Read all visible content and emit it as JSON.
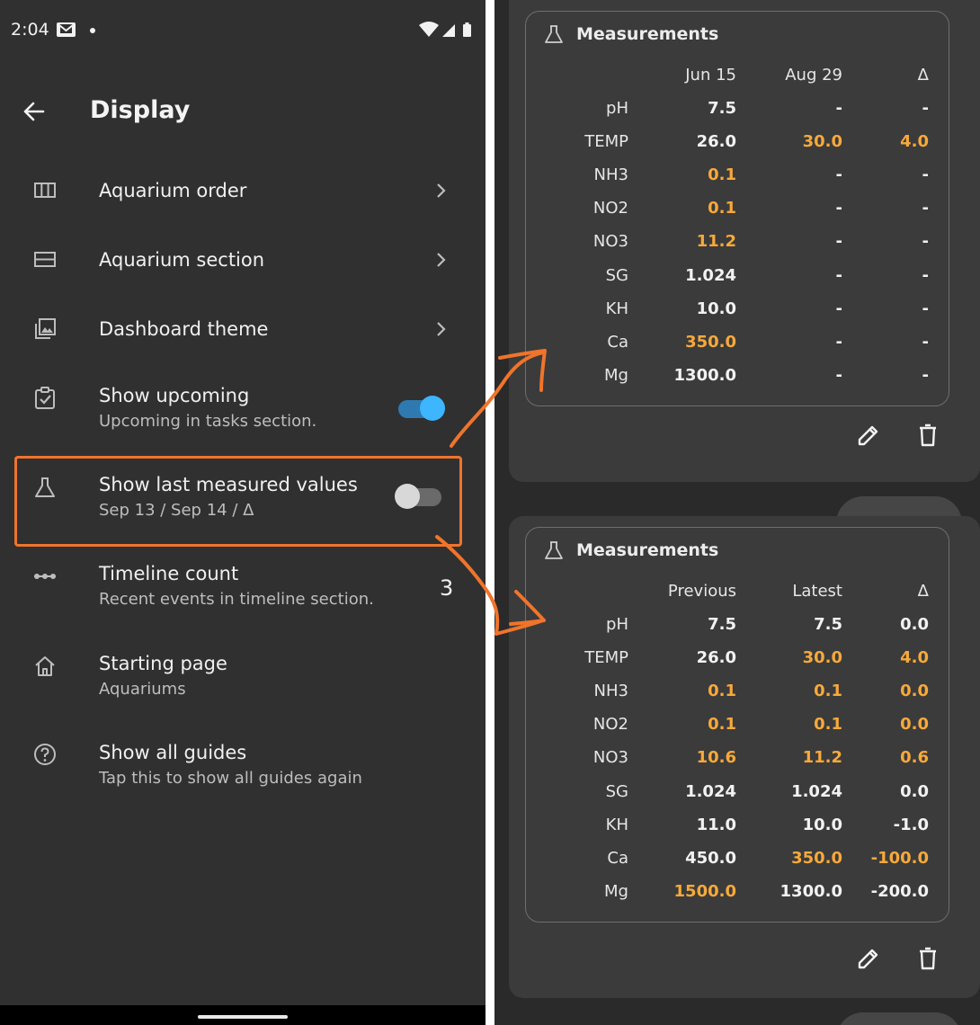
{
  "status_bar": {
    "time": "2:04"
  },
  "settings_screen": {
    "title": "Display",
    "items": [
      {
        "title": "Aquarium order"
      },
      {
        "title": "Aquarium section"
      },
      {
        "title": "Dashboard theme"
      },
      {
        "title": "Show upcoming",
        "subtitle": "Upcoming in tasks section.",
        "toggle": "on"
      },
      {
        "title": "Show last measured values",
        "subtitle": "Sep 13 / Sep 14 / Δ",
        "toggle": "off"
      },
      {
        "title": "Timeline count",
        "subtitle": "Recent events in timeline section.",
        "value": "3"
      },
      {
        "title": "Starting page",
        "subtitle": "Aquariums"
      },
      {
        "title": "Show all guides",
        "subtitle": "Tap this to show all guides again"
      }
    ]
  },
  "colors": {
    "annotation": "#f0742b",
    "highlight_value": "#f7a93b",
    "toggle_on": "#3db5ff"
  },
  "cards": [
    {
      "title": "Measurements",
      "columns": [
        "Jun 15",
        "Aug 29",
        "Δ"
      ],
      "rows": [
        {
          "param": "pH",
          "values": [
            "7.5",
            "-",
            "-"
          ],
          "highlight": [
            false,
            false,
            false
          ]
        },
        {
          "param": "TEMP",
          "values": [
            "26.0",
            "30.0",
            "4.0"
          ],
          "highlight": [
            false,
            true,
            true
          ]
        },
        {
          "param": "NH3",
          "values": [
            "0.1",
            "-",
            "-"
          ],
          "highlight": [
            true,
            false,
            false
          ]
        },
        {
          "param": "NO2",
          "values": [
            "0.1",
            "-",
            "-"
          ],
          "highlight": [
            true,
            false,
            false
          ]
        },
        {
          "param": "NO3",
          "values": [
            "11.2",
            "-",
            "-"
          ],
          "highlight": [
            true,
            false,
            false
          ]
        },
        {
          "param": "SG",
          "values": [
            "1.024",
            "-",
            "-"
          ],
          "highlight": [
            false,
            false,
            false
          ]
        },
        {
          "param": "KH",
          "values": [
            "10.0",
            "-",
            "-"
          ],
          "highlight": [
            false,
            false,
            false
          ]
        },
        {
          "param": "Ca",
          "values": [
            "350.0",
            "-",
            "-"
          ],
          "highlight": [
            true,
            false,
            false
          ]
        },
        {
          "param": "Mg",
          "values": [
            "1300.0",
            "-",
            "-"
          ],
          "highlight": [
            false,
            false,
            false
          ]
        }
      ]
    },
    {
      "title": "Measurements",
      "columns": [
        "Previous",
        "Latest",
        "Δ"
      ],
      "rows": [
        {
          "param": "pH",
          "values": [
            "7.5",
            "7.5",
            "0.0"
          ],
          "highlight": [
            false,
            false,
            false
          ]
        },
        {
          "param": "TEMP",
          "values": [
            "26.0",
            "30.0",
            "4.0"
          ],
          "highlight": [
            false,
            true,
            true
          ]
        },
        {
          "param": "NH3",
          "values": [
            "0.1",
            "0.1",
            "0.0"
          ],
          "highlight": [
            true,
            true,
            true
          ]
        },
        {
          "param": "NO2",
          "values": [
            "0.1",
            "0.1",
            "0.0"
          ],
          "highlight": [
            true,
            true,
            true
          ]
        },
        {
          "param": "NO3",
          "values": [
            "10.6",
            "11.2",
            "0.6"
          ],
          "highlight": [
            true,
            true,
            true
          ]
        },
        {
          "param": "SG",
          "values": [
            "1.024",
            "1.024",
            "0.0"
          ],
          "highlight": [
            false,
            false,
            false
          ]
        },
        {
          "param": "KH",
          "values": [
            "11.0",
            "10.0",
            "-1.0"
          ],
          "highlight": [
            false,
            false,
            false
          ]
        },
        {
          "param": "Ca",
          "values": [
            "450.0",
            "350.0",
            "-100.0"
          ],
          "highlight": [
            false,
            true,
            true
          ]
        },
        {
          "param": "Mg",
          "values": [
            "1500.0",
            "1300.0",
            "-200.0"
          ],
          "highlight": [
            true,
            false,
            false
          ]
        }
      ]
    }
  ]
}
